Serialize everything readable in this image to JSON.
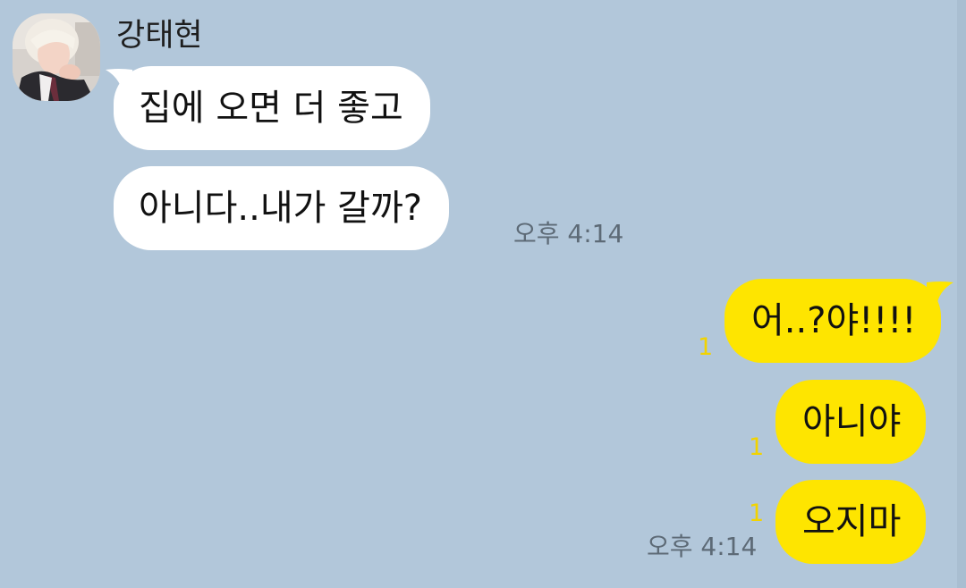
{
  "chat": {
    "sender": {
      "name": "강태현"
    },
    "incoming": [
      {
        "text": "집에 오면 더 좋고"
      },
      {
        "text": "아니다..내가 갈까?"
      }
    ],
    "incoming_time": "오후 4:14",
    "outgoing": [
      {
        "text": "어..?야!!!!",
        "unread": "1"
      },
      {
        "text": "아니야",
        "unread": "1"
      },
      {
        "text": "오지마",
        "unread": "1"
      }
    ],
    "outgoing_time": "오후 4:14"
  },
  "colors": {
    "background": "#b2c7da",
    "incoming_bubble": "#ffffff",
    "outgoing_bubble": "#fee500",
    "unread_count": "#f2d300",
    "timestamp": "#5d6a76"
  },
  "icons": {
    "avatar": "profile-photo"
  }
}
